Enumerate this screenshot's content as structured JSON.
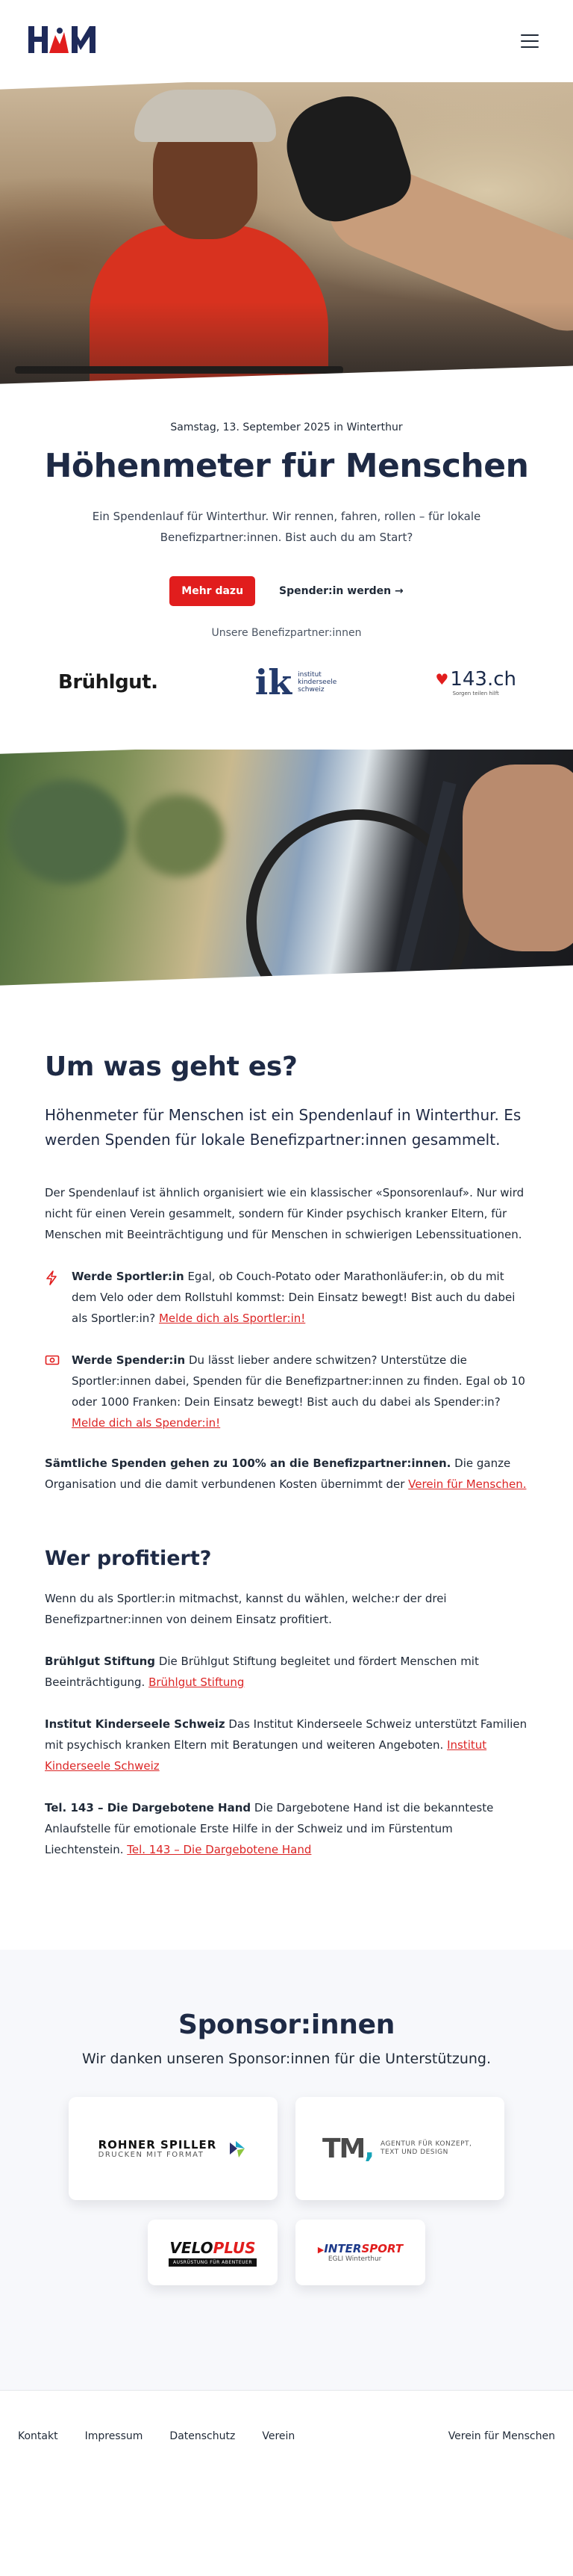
{
  "header": {
    "logo_text": "H&M",
    "logo_alt": "Höhenmeter für Menschen",
    "menu_icon": "hamburger-menu-icon"
  },
  "hero": {
    "date": "Samstag, 13. September 2025 in Winterthur",
    "title": "Höhenmeter für Menschen",
    "lead": "Ein Spendenlauf für Winterthur. Wir rennen, fahren, rollen – für lokale Benefizpartner:innen. Bist auch du am Start?",
    "primary_button": "Mehr dazu",
    "secondary_link": "Spender:in werden →",
    "partners_label": "Unsere Benefizpartner:innen"
  },
  "partners": [
    {
      "name": "Brühlgut."
    },
    {
      "name": "ik",
      "text": "institut kinderseele schweiz"
    },
    {
      "name": "143.ch",
      "text": "Sorgen teilen hilft"
    }
  ],
  "about": {
    "title": "Um was geht es?",
    "lead": "Höhenmeter für Menschen ist ein Spendenlauf in Winterthur. Es werden Spenden für lokale Benefizpartner:innen gesammelt.",
    "paragraph": "Der Spendenlauf ist ähnlich organisiert wie ein klassischer «Sponsorenlauf». Nur wird nicht für einen Verein gesammelt, sondern für Kinder psychisch kranker Eltern, für Menschen mit Beeinträchtigung und für Menschen in schwierigen Lebenssituationen.",
    "feature_athlete": {
      "icon": "lightning-bolt-icon",
      "bold": "Werde Sportler:in",
      "text": " Egal, ob Couch-Potato oder Marathonläufer:in, ob du mit dem Velo oder dem Rollstuhl kommst: Dein Einsatz bewegt! Bist auch du dabei als Sportler:in? ",
      "link": "Melde dich als Sportler:in!"
    },
    "feature_donor": {
      "icon": "money-bill-icon",
      "bold": "Werde Spender:in",
      "text": " Du lässt lieber andere schwitzen? Unterstütze die Sportler:innen dabei, Spenden für die Benefizpartner:innen zu finden. Egal ob 10 oder 1000 Franken: Dein Einsatz bewegt! Bist auch du dabei als Spender:in? ",
      "link": "Melde dich als Spender:in!"
    },
    "all_donations": {
      "bold": "Sämtliche Spenden gehen zu 100% an die Benefizpartner:innen.",
      "text": " Die ganze Organisation und die damit verbundenen Kosten übernimmt der ",
      "link": "Verein für Menschen."
    }
  },
  "beneficiaries": {
    "title": "Wer profitiert?",
    "intro": "Wenn du als Sportler:in mitmachst, kannst du wählen, welche:r der drei Benefizpartner:innen von deinem Einsatz profitiert.",
    "items": [
      {
        "bold": "Brühlgut Stiftung",
        "text": " Die Brühlgut Stiftung begleitet und fördert Menschen mit Beeinträchtigung. ",
        "link": "Brühlgut Stiftung"
      },
      {
        "bold": "Institut Kinderseele Schweiz",
        "text": " Das Institut Kinderseele Schweiz unterstützt Familien mit psychisch kranken Eltern mit Beratungen und weiteren Angeboten. ",
        "link": "Institut Kinderseele Schweiz"
      },
      {
        "bold": "Tel. 143 – Die Dargebotene Hand",
        "text": " Die Dargebotene Hand ist die bekannteste Anlaufstelle für emotionale Erste Hilfe in der Schweiz und im Fürstentum Liechtenstein. ",
        "link": "Tel. 143 – Die Dargebotene Hand"
      }
    ]
  },
  "sponsors": {
    "title": "Sponsor:innen",
    "subtitle": "Wir danken unseren Sponsor:innen für die Unterstützung.",
    "items": [
      {
        "name": "ROHNER SPILLER",
        "tag": "DRUCKEN MIT FORMAT"
      },
      {
        "name": "TM",
        "tag": "AGENTUR FÜR KONZEPT, TEXT UND DESIGN"
      },
      {
        "name": "VELO",
        "name2": "PLUS",
        "tag": "AUSRÜSTUNG FÜR ABENTEUER"
      },
      {
        "name": "INTER",
        "name2": "SPORT",
        "tag": "EGLI Winterthur"
      }
    ]
  },
  "footer": {
    "links": [
      "Kontakt",
      "Impressum",
      "Datenschutz",
      "Verein"
    ],
    "right": "Verein für Menschen"
  },
  "colors": {
    "accent": "#e11d1d",
    "heading": "#1e2a45",
    "text": "#1f2937",
    "sponsor_bg": "#f7f8fb"
  }
}
